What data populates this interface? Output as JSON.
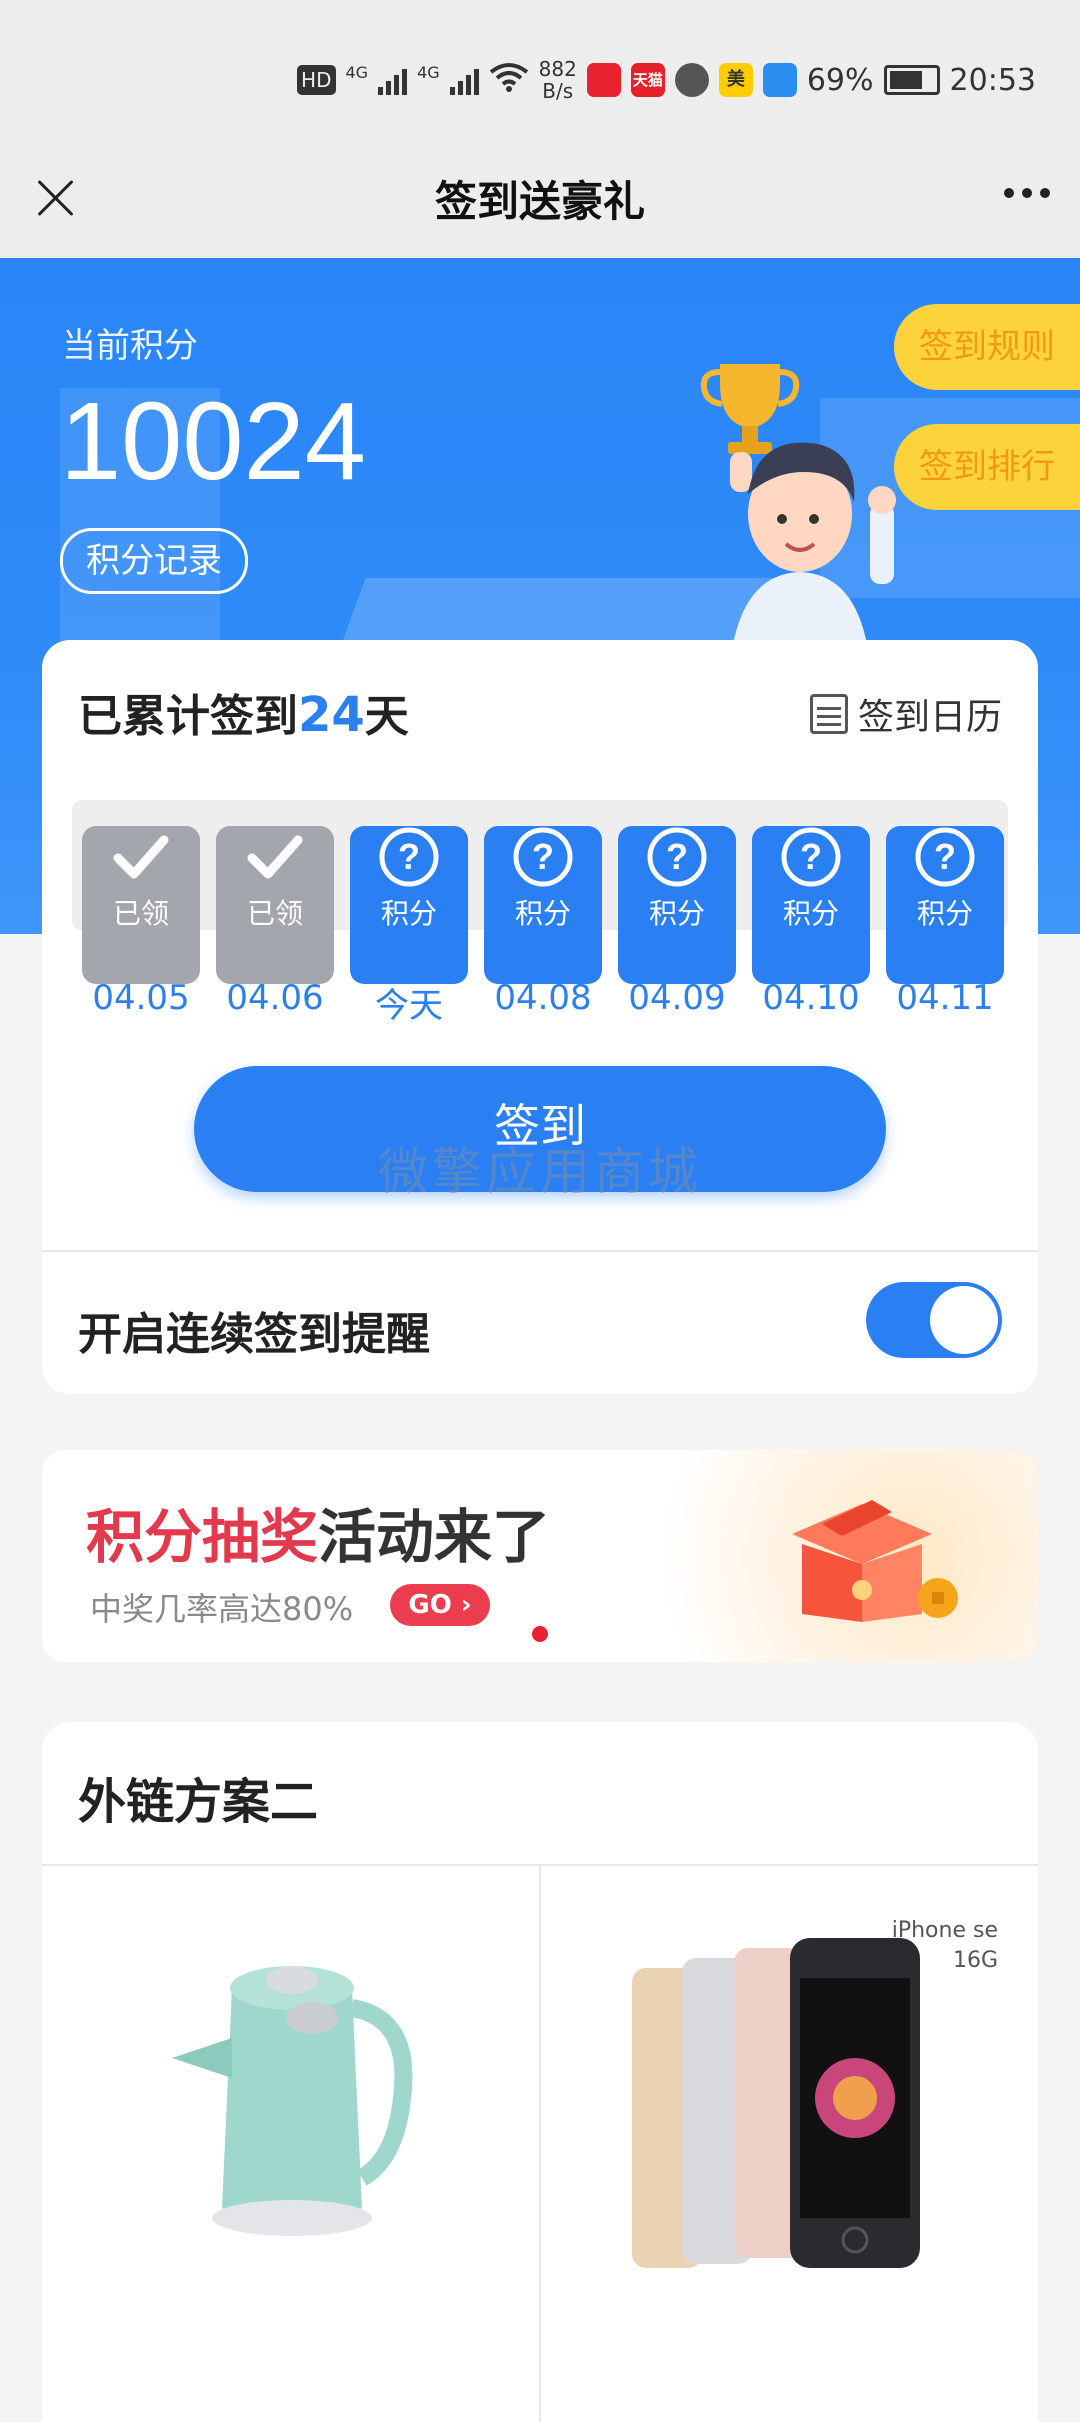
{
  "status_bar": {
    "hd": "HD",
    "net1": "4G",
    "net2": "4G",
    "speed_value": "882",
    "speed_unit": "B/s",
    "apps": [
      {
        "name": "app-red-icon",
        "label": "",
        "color": "#e8232d"
      },
      {
        "name": "tmall-icon",
        "label": "天猫",
        "color": "#e62028"
      },
      {
        "name": "gray-app-icon",
        "label": "",
        "color": "#555555"
      },
      {
        "name": "meituan-icon",
        "label": "美",
        "color": "#ffcc00"
      },
      {
        "name": "blue-app-icon",
        "label": "",
        "color": "#2a8df0"
      }
    ],
    "battery": "69%",
    "time": "20:53"
  },
  "nav": {
    "title": "签到送豪礼"
  },
  "hero": {
    "points_label": "当前积分",
    "points_value": "10024",
    "points_record": "积分记录",
    "rules_button": "签到规则",
    "ranking_button": "签到排行"
  },
  "sign_card": {
    "cumulative_prefix": "已累计签到",
    "cumulative_days": "24",
    "cumulative_suffix": "天",
    "calendar_label": "签到日历",
    "days": [
      {
        "status": "claimed",
        "label": "已领",
        "date": "04.05"
      },
      {
        "status": "claimed",
        "label": "已领",
        "date": "04.06"
      },
      {
        "status": "open",
        "label": "积分",
        "date": "今天"
      },
      {
        "status": "open",
        "label": "积分",
        "date": "04.08"
      },
      {
        "status": "open",
        "label": "积分",
        "date": "04.09"
      },
      {
        "status": "open",
        "label": "积分",
        "date": "04.10"
      },
      {
        "status": "open",
        "label": "积分",
        "date": "04.11"
      }
    ],
    "sign_button": "签到",
    "watermark": "微擎应用商城",
    "reminder_label": "开启连续签到提醒",
    "reminder_on": true
  },
  "banner": {
    "title_highlight": "积分抽奖",
    "title_rest": "活动来了",
    "subtitle": "中奖几率高达80%",
    "go_label": "GO ›"
  },
  "products": {
    "title": "外链方案二",
    "iphone_brand": "iPhone se",
    "iphone_capacity": "16G"
  }
}
